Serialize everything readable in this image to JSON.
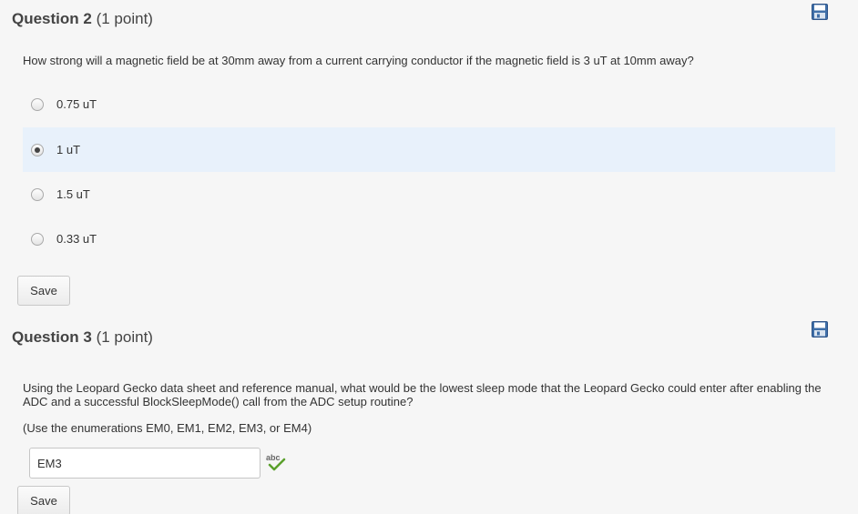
{
  "question2": {
    "number_label": "Question 2",
    "points_label": "(1 point)",
    "text": "How strong will a magnetic field be at 30mm away from a current carrying conductor if the magnetic field is 3 uT at 10mm away?",
    "options": [
      {
        "label": "0.75 uT",
        "selected": false
      },
      {
        "label": "1 uT",
        "selected": true
      },
      {
        "label": "1.5 uT",
        "selected": false
      },
      {
        "label": "0.33 uT",
        "selected": false
      }
    ],
    "save_label": "Save",
    "save_icon": "floppy-disk-icon"
  },
  "question3": {
    "number_label": "Question 3",
    "points_label": "(1 point)",
    "text": "Using the Leopard Gecko data sheet and reference manual, what would be the lowest sleep mode that the Leopard Gecko could enter after enabling the ADC and a successful BlockSleepMode() call from the ADC setup routine?",
    "hint": "(Use the enumerations EM0, EM1, EM2, EM3, or EM4)",
    "answer_value": "EM3",
    "spellcheck_icon": "spellcheck-icon",
    "save_label": "Save",
    "save_icon": "floppy-disk-icon"
  },
  "colors": {
    "selected_option_bg": "#e8f1fb",
    "icon_blue": "#3f6fa8"
  }
}
